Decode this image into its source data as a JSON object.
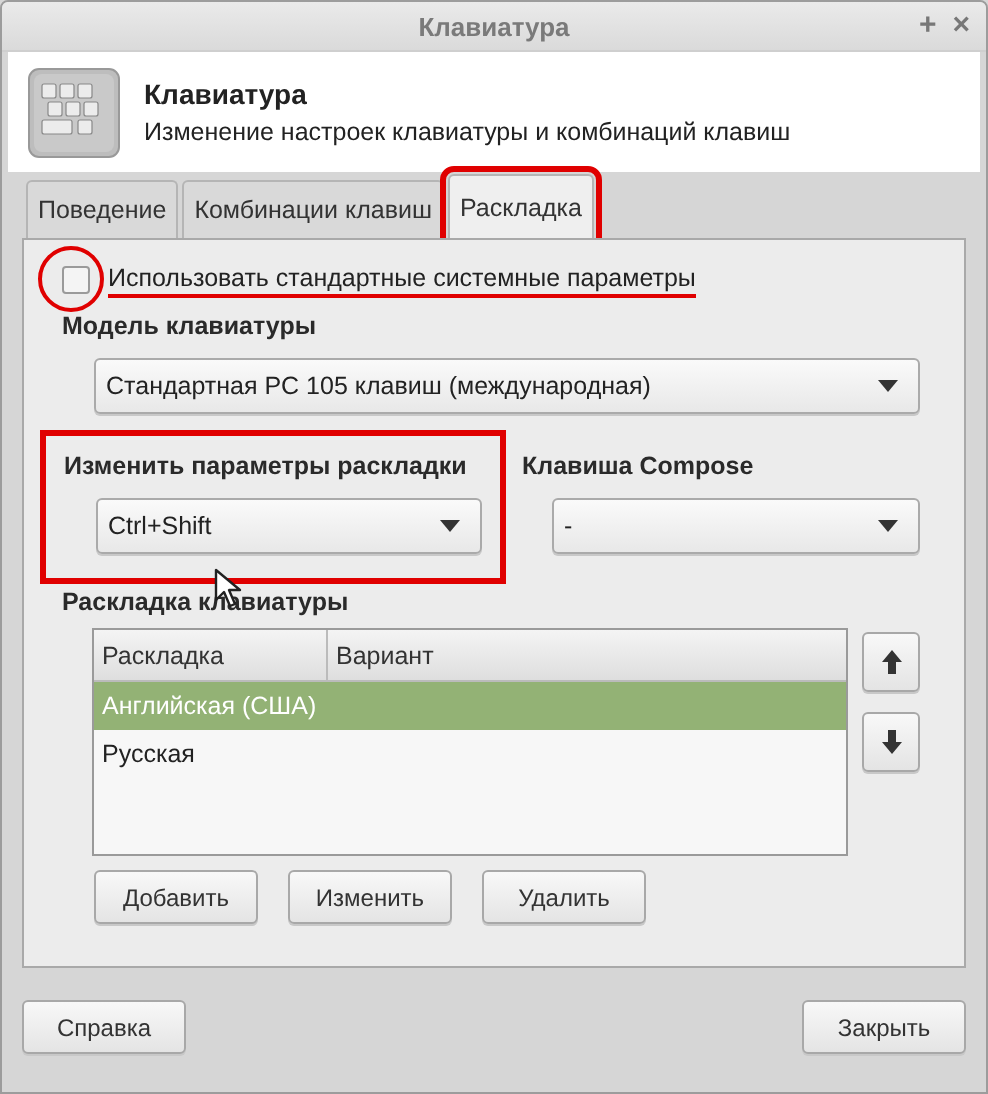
{
  "window": {
    "title": "Клавиатура",
    "controls": [
      "+",
      "×"
    ]
  },
  "header": {
    "title": "Клавиатура",
    "subtitle": "Изменение настроек клавиатуры и комбинаций клавиш"
  },
  "tabs": [
    {
      "label": "Поведение",
      "selected": false,
      "annotated": false
    },
    {
      "label": "Комбинации клавиш",
      "selected": false,
      "annotated": false
    },
    {
      "label": "Раскладка",
      "selected": true,
      "annotated": true
    }
  ],
  "use_system_defaults": {
    "label": "Использовать стандартные системные параметры",
    "checked": false,
    "annotated": true
  },
  "keyboard_model": {
    "label": "Модель клавиатуры",
    "value": "Стандартная PC 105 клавиш (международная)"
  },
  "switch_option": {
    "label": "Изменить параметры раскладки",
    "value": "Ctrl+Shift",
    "annotated": true
  },
  "compose_key": {
    "label": "Клавиша Compose",
    "value": "-"
  },
  "layouts": {
    "label": "Раскладка клавиатуры",
    "columns": [
      "Раскладка",
      "Вариант"
    ],
    "rows": [
      {
        "layout": "Английская (США)",
        "selected": true
      },
      {
        "layout": "Русская",
        "selected": false
      }
    ],
    "buttons": [
      "Добавить",
      "Изменить",
      "Удалить"
    ]
  },
  "footer_buttons": [
    "Справка",
    "Закрыть"
  ]
}
